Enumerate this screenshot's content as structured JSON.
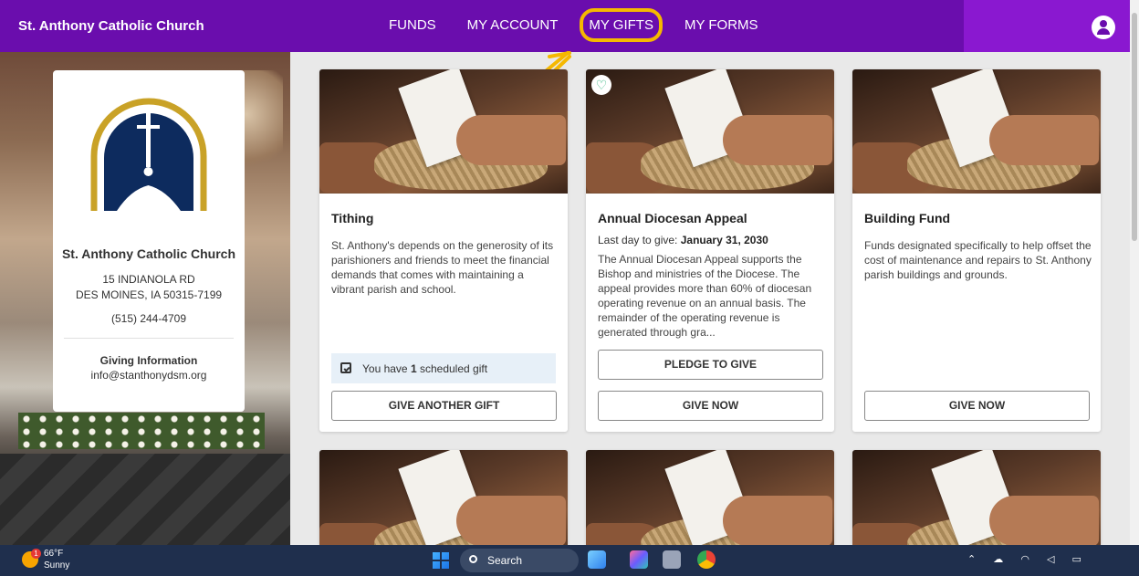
{
  "nav": {
    "brand": "St. Anthony Catholic Church",
    "menu": [
      "FUNDS",
      "MY ACCOUNT",
      "MY GIFTS",
      "MY FORMS"
    ],
    "highlighted": "MY GIFTS",
    "colors": {
      "bar": "#6a0dad",
      "highlight": "#f5b800"
    }
  },
  "church": {
    "name": "St. Anthony Catholic Church",
    "address_line1": "15 INDIANOLA RD",
    "address_line2": "DES MOINES, IA 50315-7199",
    "phone": "(515) 244-4709",
    "giving_heading": "Giving Information",
    "email": "info@stanthonydsm.org"
  },
  "funds": [
    {
      "title": "Tithing",
      "description": "St. Anthony's depends on the generosity of its parishioners and friends to meet the financial demands that comes with maintaining a vibrant parish and school.",
      "scheduled_prefix": "You have ",
      "scheduled_count": "1",
      "scheduled_suffix": " scheduled gift",
      "button": "GIVE ANOTHER GIFT"
    },
    {
      "title": "Annual Diocesan Appeal",
      "last_day_label": "Last day to give: ",
      "last_day": "January 31, 2030",
      "description": "The Annual Diocesan Appeal supports the Bishop and ministries of the Diocese. The appeal provides more than 60% of diocesan operating revenue on an annual basis. The remainder of the operating revenue is generated through gra...",
      "pledge_button": "PLEDGE TO GIVE",
      "button": "GIVE NOW",
      "badge_icon": "heart-icon"
    },
    {
      "title": "Building Fund",
      "description": "Funds designated specifically to help offset the cost of maintenance and repairs to St. Anthony parish buildings and grounds.",
      "button": "GIVE NOW"
    }
  ],
  "taskbar": {
    "temperature": "66°F",
    "condition": "Sunny",
    "weather_badge": "1",
    "search_label": "Search"
  }
}
